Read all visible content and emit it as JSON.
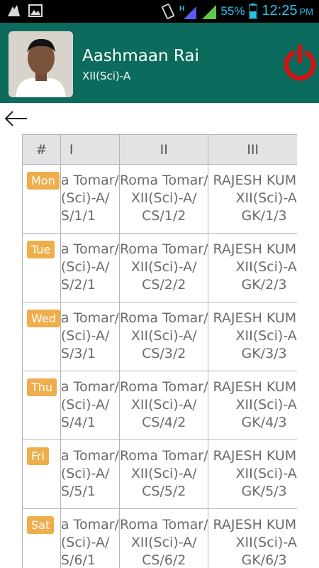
{
  "status_bar": {
    "battery_percent": "55%",
    "time": "12:25",
    "ampm": "PM",
    "icons": [
      "android-debug-icon",
      "image-icon",
      "vibrate-icon",
      "signal-h-icon",
      "signal-bars-icon",
      "battery-icon"
    ]
  },
  "header": {
    "name": "Aashmaan Rai",
    "class": "XII(Sci)-A",
    "accent_color": "#0b6b5d"
  },
  "table": {
    "columns": [
      "#",
      "I",
      "II",
      "III"
    ],
    "rows": [
      {
        "day": "Mon",
        "cells": [
          [
            "a Tomar/",
            "(Sci)-A/",
            "S/1/1"
          ],
          [
            "Roma Tomar/",
            "XII(Sci)-A/",
            "CS/1/2"
          ],
          [
            "RAJESH KUM",
            "XII(Sci)-A",
            "GK/1/3"
          ]
        ]
      },
      {
        "day": "Tue",
        "cells": [
          [
            "a Tomar/",
            "(Sci)-A/",
            "S/2/1"
          ],
          [
            "Roma Tomar/",
            "XII(Sci)-A/",
            "CS/2/2"
          ],
          [
            "RAJESH KUM",
            "XII(Sci)-A",
            "GK/2/3"
          ]
        ]
      },
      {
        "day": "Wed",
        "cells": [
          [
            "a Tomar/",
            "(Sci)-A/",
            "S/3/1"
          ],
          [
            "Roma Tomar/",
            "XII(Sci)-A/",
            "CS/3/2"
          ],
          [
            "RAJESH KUM",
            "XII(Sci)-A",
            "GK/3/3"
          ]
        ]
      },
      {
        "day": "Thu",
        "cells": [
          [
            "a Tomar/",
            "(Sci)-A/",
            "S/4/1"
          ],
          [
            "Roma Tomar/",
            "XII(Sci)-A/",
            "CS/4/2"
          ],
          [
            "RAJESH KUM",
            "XII(Sci)-A",
            "GK/4/3"
          ]
        ]
      },
      {
        "day": "Fri",
        "cells": [
          [
            "a Tomar/",
            "(Sci)-A/",
            "S/5/1"
          ],
          [
            "Roma Tomar/",
            "XII(Sci)-A/",
            "CS/5/2"
          ],
          [
            "RAJESH KUM",
            "XII(Sci)-A",
            "GK/5/3"
          ]
        ]
      },
      {
        "day": "Sat",
        "cells": [
          [
            "a Tomar/",
            "(Sci)-A/",
            "S/6/1"
          ],
          [
            "Roma Tomar/",
            "XII(Sci)-A/",
            "CS/6/2"
          ],
          [
            "RAJESH KUM",
            "XII(Sci)-A",
            "GK/6/3"
          ]
        ]
      }
    ]
  }
}
